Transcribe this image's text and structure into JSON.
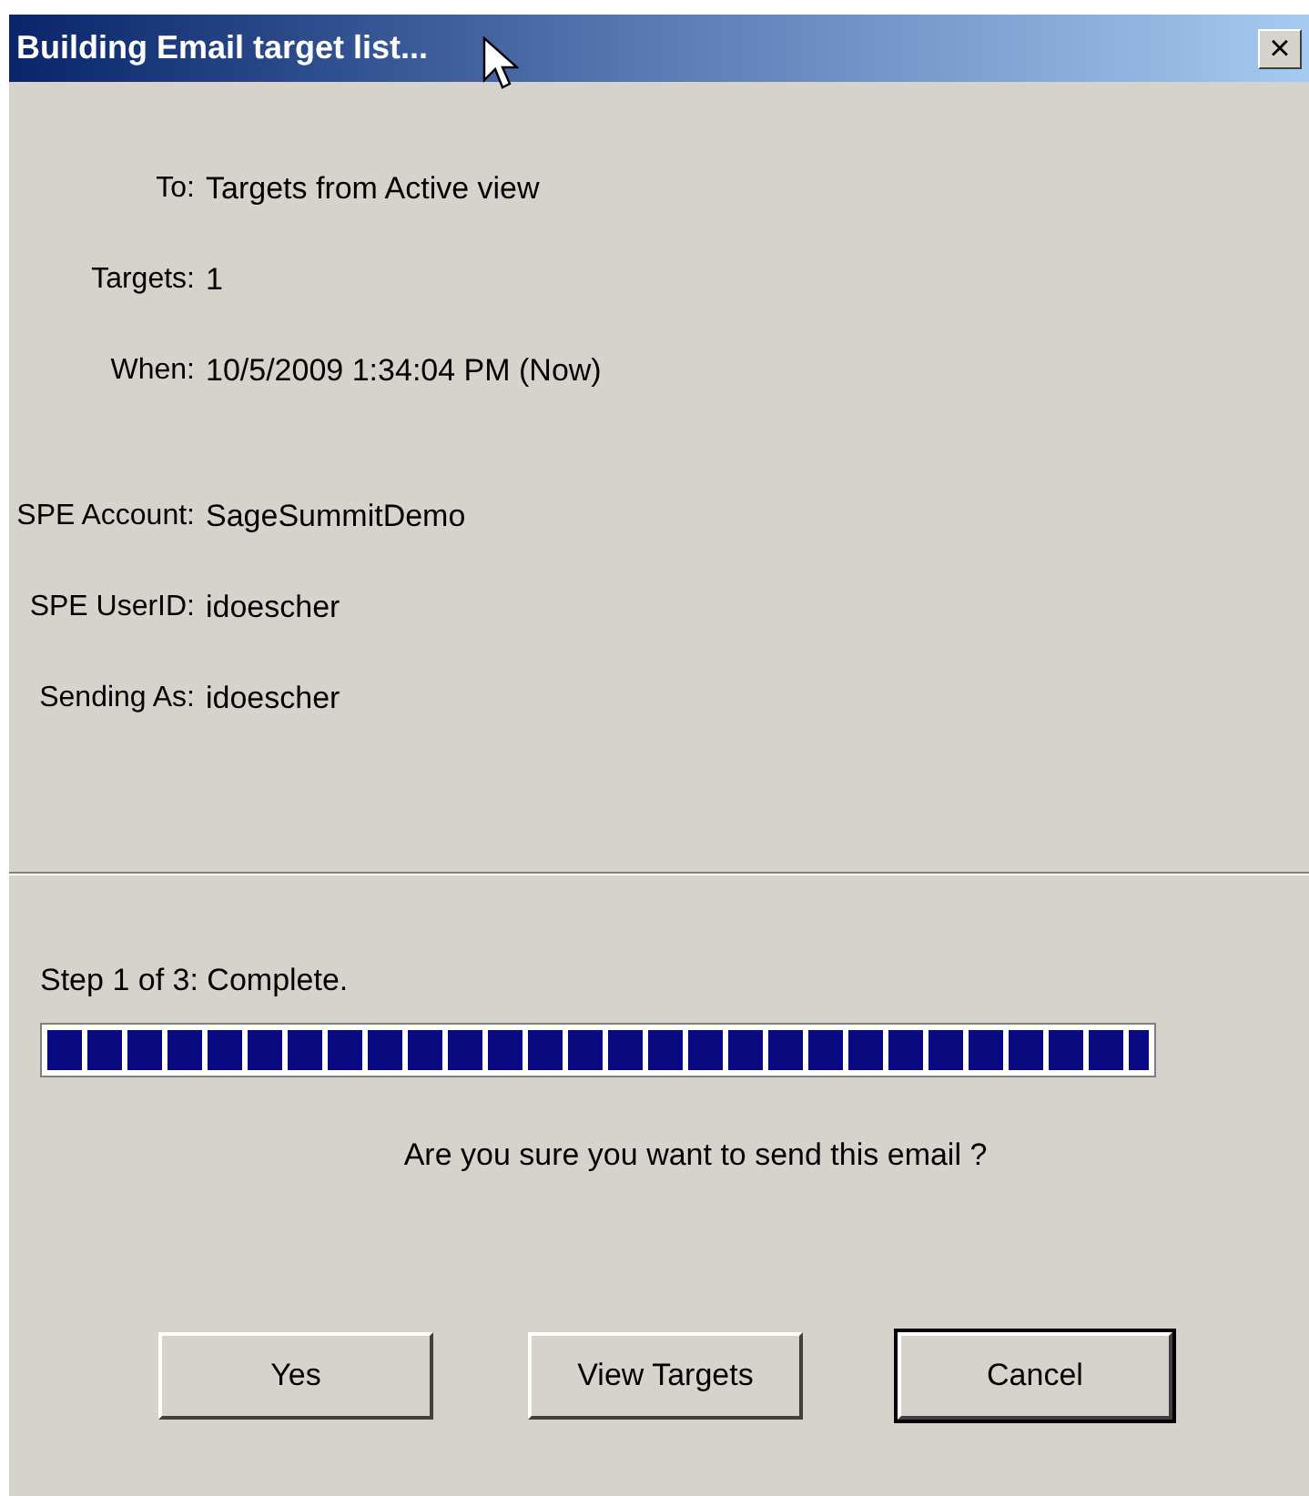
{
  "window": {
    "title": "Building Email target list...",
    "close": "×"
  },
  "details_top": [
    {
      "label": "To:",
      "value": "Targets from Active view"
    },
    {
      "label": "Targets:",
      "value": "1"
    },
    {
      "label": "When:",
      "value": "10/5/2009 1:34:04 PM (Now)"
    }
  ],
  "details_account": [
    {
      "label": "SPE Account:",
      "value": "SageSummitDemo"
    },
    {
      "label": "SPE UserID:",
      "value": "idoescher"
    },
    {
      "label": "Sending As:",
      "value": "idoescher"
    }
  ],
  "progress": {
    "status": "Step 1 of 3: Complete.",
    "level": 1
  },
  "question": "Are you sure you want to send this email ?",
  "buttons": [
    {
      "label": "Yes",
      "default": false
    },
    {
      "label": "View Targets",
      "default": false
    },
    {
      "label": "Cancel",
      "default": true
    }
  ]
}
